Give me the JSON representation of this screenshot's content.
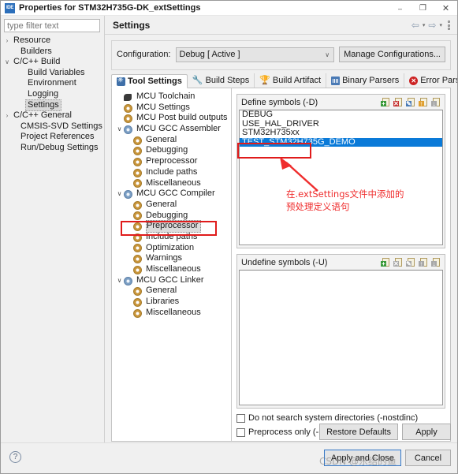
{
  "window": {
    "title": "Properties for STM32H735G-DK_extSettings",
    "app_icon": "ide-icon",
    "minimize": "–",
    "maximize": "❐",
    "close": "✕"
  },
  "left": {
    "filter_placeholder": "type filter text",
    "filter_value": "",
    "tree": [
      {
        "label": "Resource",
        "indent": 0,
        "twisty": "›",
        "selected": false
      },
      {
        "label": "Builders",
        "indent": 1,
        "twisty": "",
        "selected": false
      },
      {
        "label": "C/C++ Build",
        "indent": 0,
        "twisty": "∨",
        "selected": false
      },
      {
        "label": "Build Variables",
        "indent": 2,
        "twisty": "",
        "selected": false
      },
      {
        "label": "Environment",
        "indent": 2,
        "twisty": "",
        "selected": false
      },
      {
        "label": "Logging",
        "indent": 2,
        "twisty": "",
        "selected": false
      },
      {
        "label": "Settings",
        "indent": 2,
        "twisty": "",
        "selected": true
      },
      {
        "label": "C/C++ General",
        "indent": 0,
        "twisty": "›",
        "selected": false
      },
      {
        "label": "CMSIS-SVD Settings",
        "indent": 1,
        "twisty": "",
        "selected": false
      },
      {
        "label": "Project References",
        "indent": 1,
        "twisty": "",
        "selected": false
      },
      {
        "label": "Run/Debug Settings",
        "indent": 1,
        "twisty": "",
        "selected": false
      }
    ]
  },
  "page": {
    "title": "Settings",
    "nav_back": "⇦",
    "nav_forward": "⇨",
    "nav_caret": "▾"
  },
  "config": {
    "label": "Configuration:",
    "value": "Debug  [ Active ]",
    "caret": "∨",
    "manage_button": "Manage Configurations..."
  },
  "tabs": [
    {
      "label": "Tool Settings",
      "icon": "snowflake-icon",
      "active": true
    },
    {
      "label": "Build Steps",
      "icon": "wrench-icon",
      "active": false
    },
    {
      "label": "Build Artifact",
      "icon": "trophy-icon",
      "active": false
    },
    {
      "label": "Binary Parsers",
      "icon": "binary-file-icon",
      "active": false
    },
    {
      "label": "Error Parsers",
      "icon": "error-circle-icon",
      "active": false
    }
  ],
  "tool_tree": [
    {
      "label": "MCU Toolchain",
      "indent": 0,
      "twisty": "",
      "icon": "chip-icon",
      "selected": false
    },
    {
      "label": "MCU Settings",
      "indent": 0,
      "twisty": "",
      "icon": "gear-icon",
      "selected": false
    },
    {
      "label": "MCU Post build outputs",
      "indent": 0,
      "twisty": "",
      "icon": "gear-icon",
      "selected": false
    },
    {
      "label": "MCU GCC Assembler",
      "indent": 0,
      "twisty": "∨",
      "icon": "cog-icon",
      "selected": false
    },
    {
      "label": "General",
      "indent": 1,
      "twisty": "",
      "icon": "gear-icon",
      "selected": false
    },
    {
      "label": "Debugging",
      "indent": 1,
      "twisty": "",
      "icon": "gear-icon",
      "selected": false
    },
    {
      "label": "Preprocessor",
      "indent": 1,
      "twisty": "",
      "icon": "gear-icon",
      "selected": false
    },
    {
      "label": "Include paths",
      "indent": 1,
      "twisty": "",
      "icon": "gear-icon",
      "selected": false
    },
    {
      "label": "Miscellaneous",
      "indent": 1,
      "twisty": "",
      "icon": "gear-icon",
      "selected": false
    },
    {
      "label": "MCU GCC Compiler",
      "indent": 0,
      "twisty": "∨",
      "icon": "cog-icon",
      "selected": false
    },
    {
      "label": "General",
      "indent": 1,
      "twisty": "",
      "icon": "gear-icon",
      "selected": false
    },
    {
      "label": "Debugging",
      "indent": 1,
      "twisty": "",
      "icon": "gear-icon",
      "selected": false
    },
    {
      "label": "Preprocessor",
      "indent": 1,
      "twisty": "",
      "icon": "gear-icon",
      "selected": true
    },
    {
      "label": "Include paths",
      "indent": 1,
      "twisty": "",
      "icon": "gear-icon",
      "selected": false
    },
    {
      "label": "Optimization",
      "indent": 1,
      "twisty": "",
      "icon": "gear-icon",
      "selected": false
    },
    {
      "label": "Warnings",
      "indent": 1,
      "twisty": "",
      "icon": "gear-icon",
      "selected": false
    },
    {
      "label": "Miscellaneous",
      "indent": 1,
      "twisty": "",
      "icon": "gear-icon",
      "selected": false
    },
    {
      "label": "MCU GCC Linker",
      "indent": 0,
      "twisty": "∨",
      "icon": "cog-icon",
      "selected": false
    },
    {
      "label": "General",
      "indent": 1,
      "twisty": "",
      "icon": "gear-icon",
      "selected": false
    },
    {
      "label": "Libraries",
      "indent": 1,
      "twisty": "",
      "icon": "gear-icon",
      "selected": false
    },
    {
      "label": "Miscellaneous",
      "indent": 1,
      "twisty": "",
      "icon": "gear-icon",
      "selected": false
    }
  ],
  "define_symbols": {
    "title": "Define symbols (-D)",
    "tools": [
      {
        "name": "add-symbol-icon",
        "glyph": "+",
        "color": "b-green"
      },
      {
        "name": "delete-symbol-icon",
        "glyph": "✕",
        "color": "b-red"
      },
      {
        "name": "edit-symbol-icon",
        "glyph": "✎",
        "color": "b-blue"
      },
      {
        "name": "move-up-icon",
        "glyph": "↑",
        "color": "b-orange"
      },
      {
        "name": "move-down-icon",
        "glyph": "↓",
        "color": "b-gray"
      }
    ],
    "items": [
      {
        "value": "DEBUG",
        "selected": false
      },
      {
        "value": "USE_HAL_DRIVER",
        "selected": false
      },
      {
        "value": "STM32H735xx",
        "selected": false
      },
      {
        "value": "TEST_STM32H735G_DEMO",
        "selected": true
      }
    ],
    "selection_color": "#0a7ad8"
  },
  "undefine_symbols": {
    "title": "Undefine symbols (-U)",
    "tools": [
      {
        "name": "add-symbol-icon",
        "glyph": "+",
        "color": "b-green"
      },
      {
        "name": "delete-symbol-icon",
        "glyph": "✕",
        "color": "b-gray"
      },
      {
        "name": "edit-symbol-icon",
        "glyph": "✎",
        "color": "b-gray"
      },
      {
        "name": "move-up-icon",
        "glyph": "↑",
        "color": "b-gray"
      },
      {
        "name": "move-down-icon",
        "glyph": "↓",
        "color": "b-gray"
      }
    ],
    "items": []
  },
  "checkboxes": [
    {
      "label": "Do not search system directories (-nostdinc)",
      "checked": false
    },
    {
      "label": "Preprocess only (-E)",
      "checked": false
    }
  ],
  "inner_buttons": [
    {
      "label": "Restore Defaults",
      "primary": false
    },
    {
      "label": "Apply",
      "primary": false
    }
  ],
  "footer": {
    "help_icon": "?",
    "buttons": [
      {
        "label": "Apply and Close",
        "primary": true
      },
      {
        "label": "Cancel",
        "primary": false
      }
    ]
  },
  "annotation": {
    "line1": "在.extSettings文件中添加的",
    "line2": "预处理定义语句",
    "color": "#ef2d2d"
  },
  "watermark": {
    "text": "CSDN @东结的鱼"
  }
}
